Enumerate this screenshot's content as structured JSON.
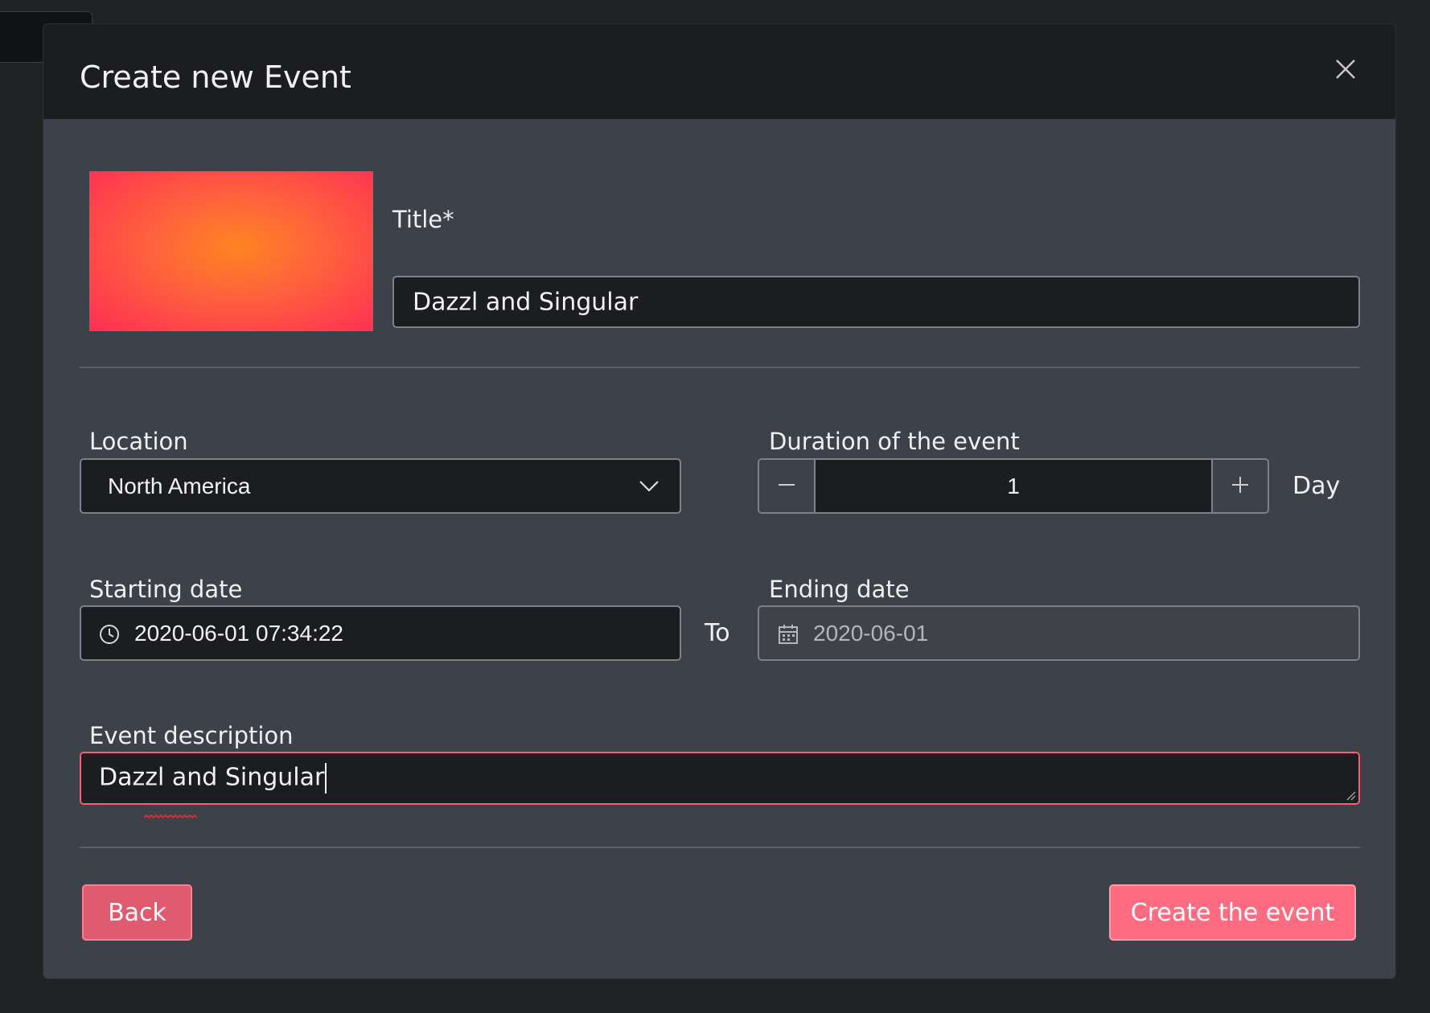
{
  "modal": {
    "title": "Create new Event"
  },
  "event_title": {
    "label": "Title*",
    "value": "Dazzl and Singular"
  },
  "location": {
    "label": "Location",
    "value": "North America"
  },
  "duration": {
    "label": "Duration of the event",
    "value": "1",
    "minus": "–",
    "plus": "+",
    "unit": "Day"
  },
  "starting_date": {
    "label": "Starting date",
    "value": "2020-06-01 07:34:22"
  },
  "separator": "To",
  "ending_date": {
    "label": "Ending date",
    "value": "2020-06-01"
  },
  "description": {
    "label": "Event description",
    "value": "Dazzl and Singular"
  },
  "actions": {
    "back": "Back",
    "create": "Create the event"
  },
  "colors": {
    "accent": "#ff6b81",
    "focus_border": "#ff5a72",
    "back_button": "#e05a70"
  },
  "icons": {
    "close": "close-icon",
    "dropdown": "chevron-down-icon",
    "clock": "clock-icon",
    "calendar": "calendar-icon",
    "minus": "minus-icon",
    "plus": "plus-icon"
  }
}
